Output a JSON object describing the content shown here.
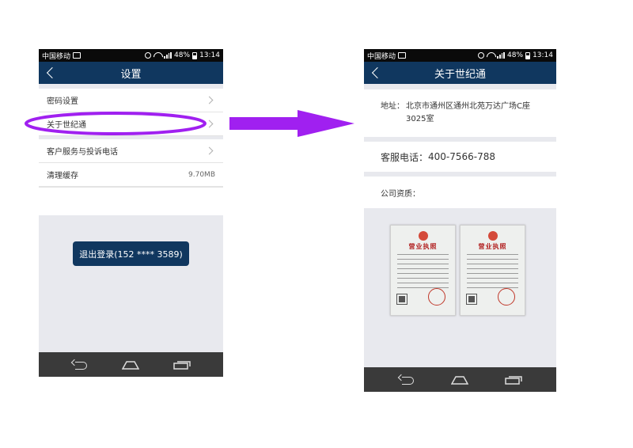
{
  "status_bar": {
    "carrier": "中国移动",
    "battery": "48%",
    "time": "13:14"
  },
  "left_screen": {
    "title": "设置",
    "items": [
      {
        "label": "密码设置"
      },
      {
        "label": "关于世纪通"
      },
      {
        "label": "客户服务与投诉电话"
      }
    ],
    "cache": {
      "label": "清理缓存",
      "value": "9.70MB"
    },
    "logout_button": "退出登录(152 **** 3589)"
  },
  "right_screen": {
    "title": "关于世纪通",
    "address_label": "地址：",
    "address_value": "北京市通州区通州北苑万达广场C座3025室",
    "phone_label": "客服电话：",
    "phone_value": "400-7566-788",
    "qualification_label": "公司资质：",
    "certificate_title": "营业执照"
  },
  "annotation_colors": {
    "highlight": "#a020f0",
    "arrow": "#a020f0",
    "header": "#10375f"
  }
}
